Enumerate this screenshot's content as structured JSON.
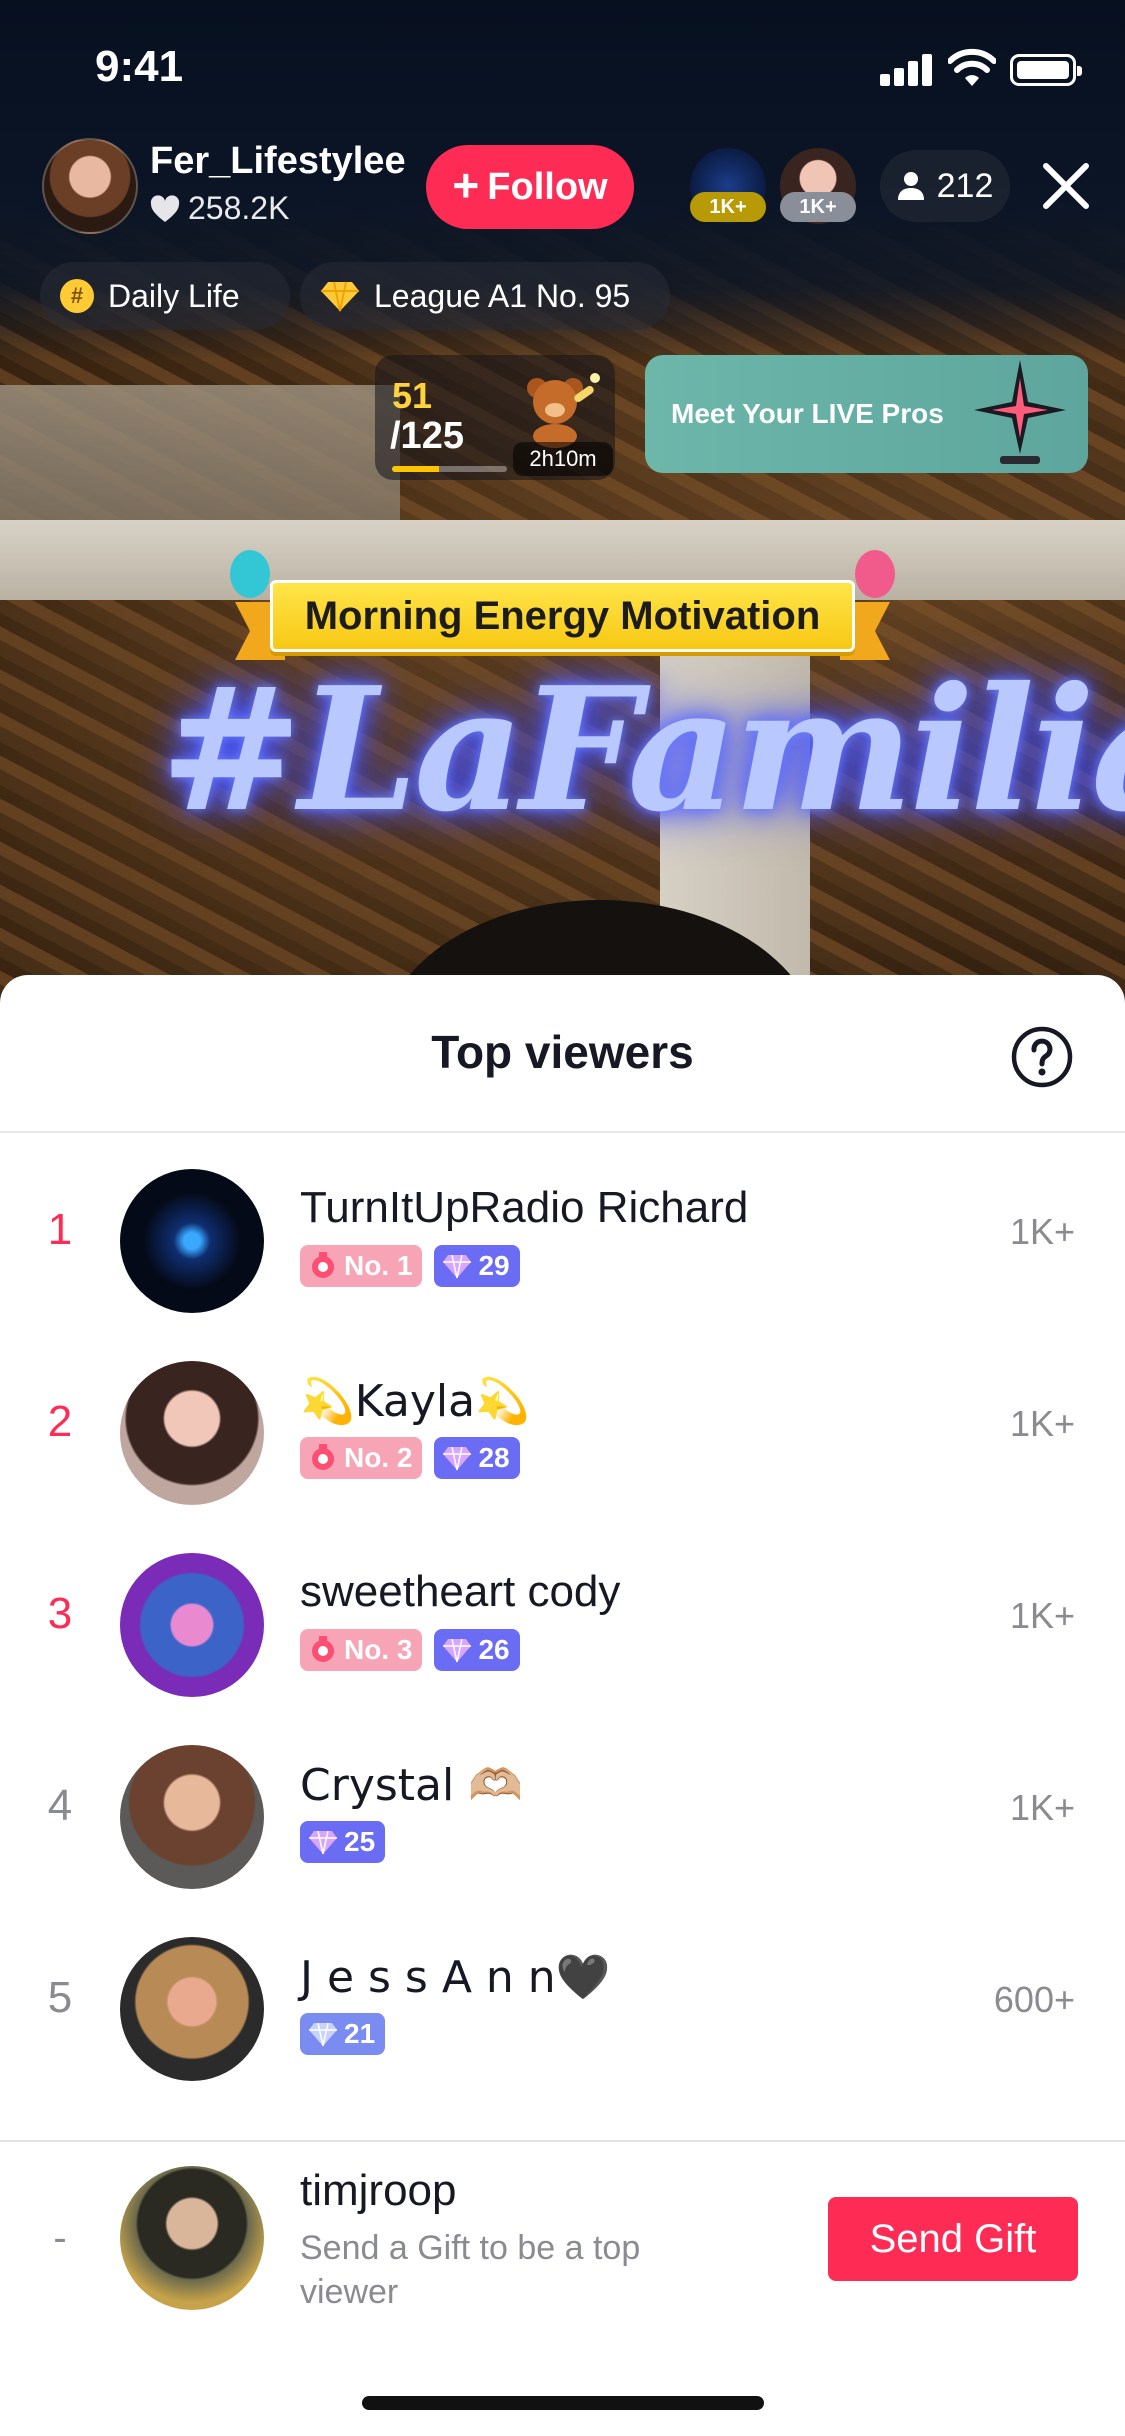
{
  "status_bar": {
    "time": "9:41"
  },
  "live_header": {
    "host_name": "Fer_Lifestylee",
    "host_likes": "258.2K",
    "follow_label": "Follow",
    "top_gifter_badges": [
      "1K+",
      "1K+"
    ],
    "viewer_count": "212",
    "tags": [
      {
        "icon": "hashtag-icon",
        "label": "Daily Life"
      },
      {
        "icon": "diamond-icon",
        "label": "League A1 No. 95"
      }
    ],
    "goal": {
      "current": "51",
      "total": "/125",
      "progress": 0.41,
      "time_left": "2h10m"
    },
    "promo_banner": "Meet Your LIVE Pros",
    "stream_title": "Morning Energy Motivation"
  },
  "sheet": {
    "title": "Top viewers",
    "viewers": [
      {
        "rank": "1",
        "name": "TurnItUpRadio Richard",
        "rank_badge": "No. 1",
        "level": "29",
        "amount": "1K+"
      },
      {
        "rank": "2",
        "name": "💫Kayla💫",
        "rank_badge": "No. 2",
        "level": "28",
        "amount": "1K+"
      },
      {
        "rank": "3",
        "name": "sweetheart cody",
        "rank_badge": "No. 3",
        "level": "26",
        "amount": "1K+"
      },
      {
        "rank": "4",
        "name": "Crystal 🫶🏼",
        "level": "25",
        "amount": "1K+"
      },
      {
        "rank": "5",
        "name": "J e s s A n n🖤",
        "level": "21",
        "amount": "600+"
      }
    ],
    "me": {
      "rank": "-",
      "name": "timjroop",
      "hint": "Send a Gift to be a top viewer",
      "send_gift_label": "Send Gift"
    }
  },
  "colors": {
    "accent": "#fe2c55",
    "level_badge": "#6a6cf4",
    "rank_badge": "#f7a4b6"
  }
}
